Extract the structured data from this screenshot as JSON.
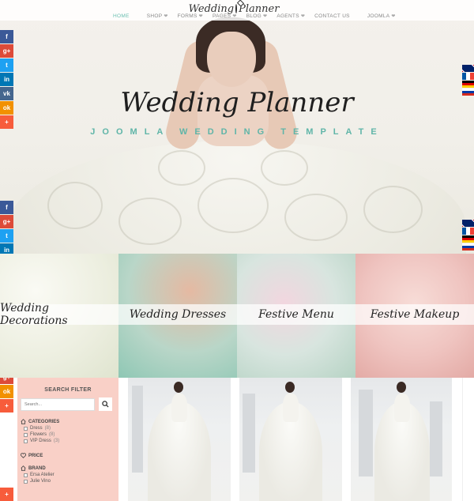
{
  "brand": {
    "logo_text_left": "Wedding",
    "logo_text_right": "Planner"
  },
  "nav": {
    "items": [
      {
        "label": "HOME",
        "active": true,
        "has_heart": false
      },
      {
        "label": "SHOP",
        "active": false,
        "has_heart": true
      },
      {
        "label": "FORMS",
        "active": false,
        "has_heart": true
      },
      {
        "label": "PAGES",
        "active": false,
        "has_heart": true
      },
      {
        "label": "BLOG",
        "active": false,
        "has_heart": true
      },
      {
        "label": "AGENTS",
        "active": false,
        "has_heart": true
      },
      {
        "label": "CONTACT US",
        "active": false,
        "has_heart": false
      },
      {
        "label": "JOOMLA",
        "active": false,
        "has_heart": true
      }
    ],
    "heart_glyph": "❤"
  },
  "hero": {
    "title": "Wedding Planner",
    "subtitle": "JOOMLA WEDDING TEMPLATE"
  },
  "social": {
    "icons": [
      {
        "name": "facebook-icon",
        "glyph": "f",
        "cls": "fb"
      },
      {
        "name": "googleplus-icon",
        "glyph": "g+",
        "cls": "gp"
      },
      {
        "name": "twitter-icon",
        "glyph": "t",
        "cls": "tw"
      },
      {
        "name": "linkedin-icon",
        "glyph": "in",
        "cls": "li"
      },
      {
        "name": "vk-icon",
        "glyph": "vk",
        "cls": "vk"
      },
      {
        "name": "odnoklassniki-icon",
        "glyph": "ok",
        "cls": "ok"
      },
      {
        "name": "share-plus-icon",
        "glyph": "+",
        "cls": "pl"
      }
    ]
  },
  "languages": [
    "en",
    "fr",
    "de",
    "ru"
  ],
  "categories": [
    {
      "label": "Wedding Decorations"
    },
    {
      "label": "Wedding Dresses"
    },
    {
      "label": "Festive Menu"
    },
    {
      "label": "Festive Makeup"
    }
  ],
  "filter": {
    "title": "SEARCH FILTER",
    "search_placeholder": "Search...",
    "categories_heading": "CATEGORIES",
    "category_options": [
      {
        "label": "Dress",
        "count": "(8)"
      },
      {
        "label": "Flowers",
        "count": "(8)"
      },
      {
        "label": "VIP Dress",
        "count": "(3)"
      }
    ],
    "price_heading": "PRICE",
    "brand_heading": "BRAND",
    "brand_options": [
      {
        "label": "Ersa Atelier"
      },
      {
        "label": "Julie Vino"
      }
    ]
  },
  "colors": {
    "accent": "#5fb5a8",
    "filter_bg": "#f9d0c7",
    "nav_active": "#6bbfb1"
  }
}
